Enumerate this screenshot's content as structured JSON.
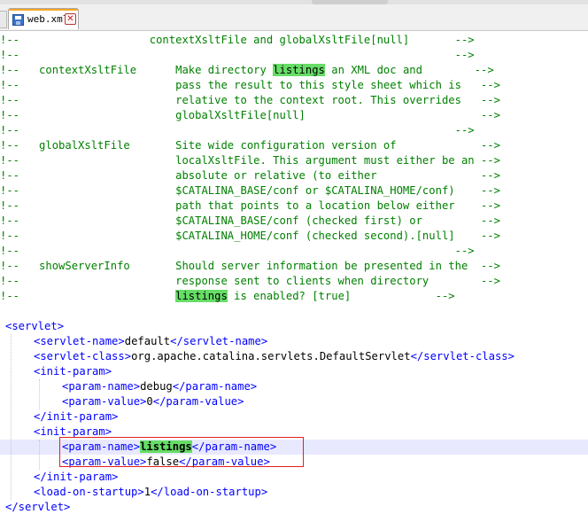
{
  "tab": {
    "title": "web.xml",
    "close_glyph": "✕",
    "icon": "save-icon"
  },
  "editor": {
    "comment_lines": [
      {
        "parts": [
          {
            "t": "!--                    contextXsltFile and globalXsltFile[null]       -->"
          }
        ]
      },
      {
        "parts": [
          {
            "t": "!--                                                                   -->"
          }
        ]
      },
      {
        "parts": [
          {
            "t": "!--   contextXsltFile      Make directory "
          },
          {
            "t": "listings",
            "hl": true
          },
          {
            "t": " an XML doc and        -->"
          }
        ]
      },
      {
        "parts": [
          {
            "t": "!--                        pass the result to this style sheet which is   -->"
          }
        ]
      },
      {
        "parts": [
          {
            "t": "!--                        relative to the context root. This overrides   -->"
          }
        ]
      },
      {
        "parts": [
          {
            "t": "!--                        globalXsltFile[null]                           -->"
          }
        ]
      },
      {
        "parts": [
          {
            "t": "!--                                                                   -->"
          }
        ]
      },
      {
        "parts": [
          {
            "t": "!--   globalXsltFile       Site wide configuration version of             -->"
          }
        ]
      },
      {
        "parts": [
          {
            "t": "!--                        localXsltFile. This argument must either be an -->"
          }
        ]
      },
      {
        "parts": [
          {
            "t": "!--                        absolute or relative (to either                -->"
          }
        ]
      },
      {
        "parts": [
          {
            "t": "!--                        $CATALINA_BASE/conf or $CATALINA_HOME/conf)    -->"
          }
        ]
      },
      {
        "parts": [
          {
            "t": "!--                        path that points to a location below either    -->"
          }
        ]
      },
      {
        "parts": [
          {
            "t": "!--                        $CATALINA_BASE/conf (checked first) or         -->"
          }
        ]
      },
      {
        "parts": [
          {
            "t": "!--                        $CATALINA_HOME/conf (checked second).[null]    -->"
          }
        ]
      },
      {
        "parts": [
          {
            "t": "!--                                                                   -->"
          }
        ]
      },
      {
        "parts": [
          {
            "t": "!--   showServerInfo       Should server information be presented in the  -->"
          }
        ]
      },
      {
        "parts": [
          {
            "t": "!--                        response sent to clients when directory        -->"
          }
        ]
      },
      {
        "parts": [
          {
            "t": "!--                        "
          },
          {
            "t": "listings",
            "hl": true
          },
          {
            "t": " is enabled? [true]             -->"
          }
        ]
      }
    ],
    "xml_lines": [
      {
        "indent": 0,
        "parts": [
          {
            "t": "<servlet>",
            "k": "tag"
          }
        ]
      },
      {
        "indent": 1,
        "parts": [
          {
            "t": "<servlet-name>",
            "k": "tag"
          },
          {
            "t": "default",
            "k": "txt"
          },
          {
            "t": "</servlet-name>",
            "k": "tag"
          }
        ]
      },
      {
        "indent": 1,
        "parts": [
          {
            "t": "<servlet-class>",
            "k": "tag"
          },
          {
            "t": "org.apache.catalina.servlets.DefaultServlet",
            "k": "txt"
          },
          {
            "t": "</servlet-class>",
            "k": "tag"
          }
        ]
      },
      {
        "indent": 1,
        "parts": [
          {
            "t": "<init-param>",
            "k": "tag"
          }
        ]
      },
      {
        "indent": 2,
        "parts": [
          {
            "t": "<param-name>",
            "k": "tag"
          },
          {
            "t": "debug",
            "k": "txt"
          },
          {
            "t": "</param-name>",
            "k": "tag"
          }
        ]
      },
      {
        "indent": 2,
        "parts": [
          {
            "t": "<param-value>",
            "k": "tag"
          },
          {
            "t": "0",
            "k": "txt"
          },
          {
            "t": "</param-value>",
            "k": "tag"
          }
        ]
      },
      {
        "indent": 1,
        "parts": [
          {
            "t": "</init-param>",
            "k": "tag"
          }
        ]
      },
      {
        "indent": 1,
        "parts": [
          {
            "t": "<init-param>",
            "k": "tag"
          }
        ]
      },
      {
        "indent": 2,
        "current": true,
        "parts": [
          {
            "t": "<param-name>",
            "k": "tag"
          },
          {
            "t": "listings",
            "k": "hl-b"
          },
          {
            "t": "</param-name>",
            "k": "tag"
          }
        ]
      },
      {
        "indent": 2,
        "parts": [
          {
            "t": "<param-value>",
            "k": "tag"
          },
          {
            "t": "false",
            "k": "txt"
          },
          {
            "t": "</param-value>",
            "k": "tag"
          }
        ]
      },
      {
        "indent": 1,
        "parts": [
          {
            "t": "</init-param>",
            "k": "tag"
          }
        ]
      },
      {
        "indent": 1,
        "parts": [
          {
            "t": "<load-on-startup>",
            "k": "tag"
          },
          {
            "t": "1",
            "k": "txt"
          },
          {
            "t": "</load-on-startup>",
            "k": "tag"
          }
        ]
      },
      {
        "indent": 0,
        "parts": [
          {
            "t": "</servlet>",
            "k": "tag"
          }
        ]
      }
    ]
  },
  "colors": {
    "comment": "#008000",
    "tag": "#0000ff",
    "text": "#000000",
    "match_highlight": "#66dd66",
    "current_line": "#e8e8ff",
    "selection_box": "#e02020"
  }
}
